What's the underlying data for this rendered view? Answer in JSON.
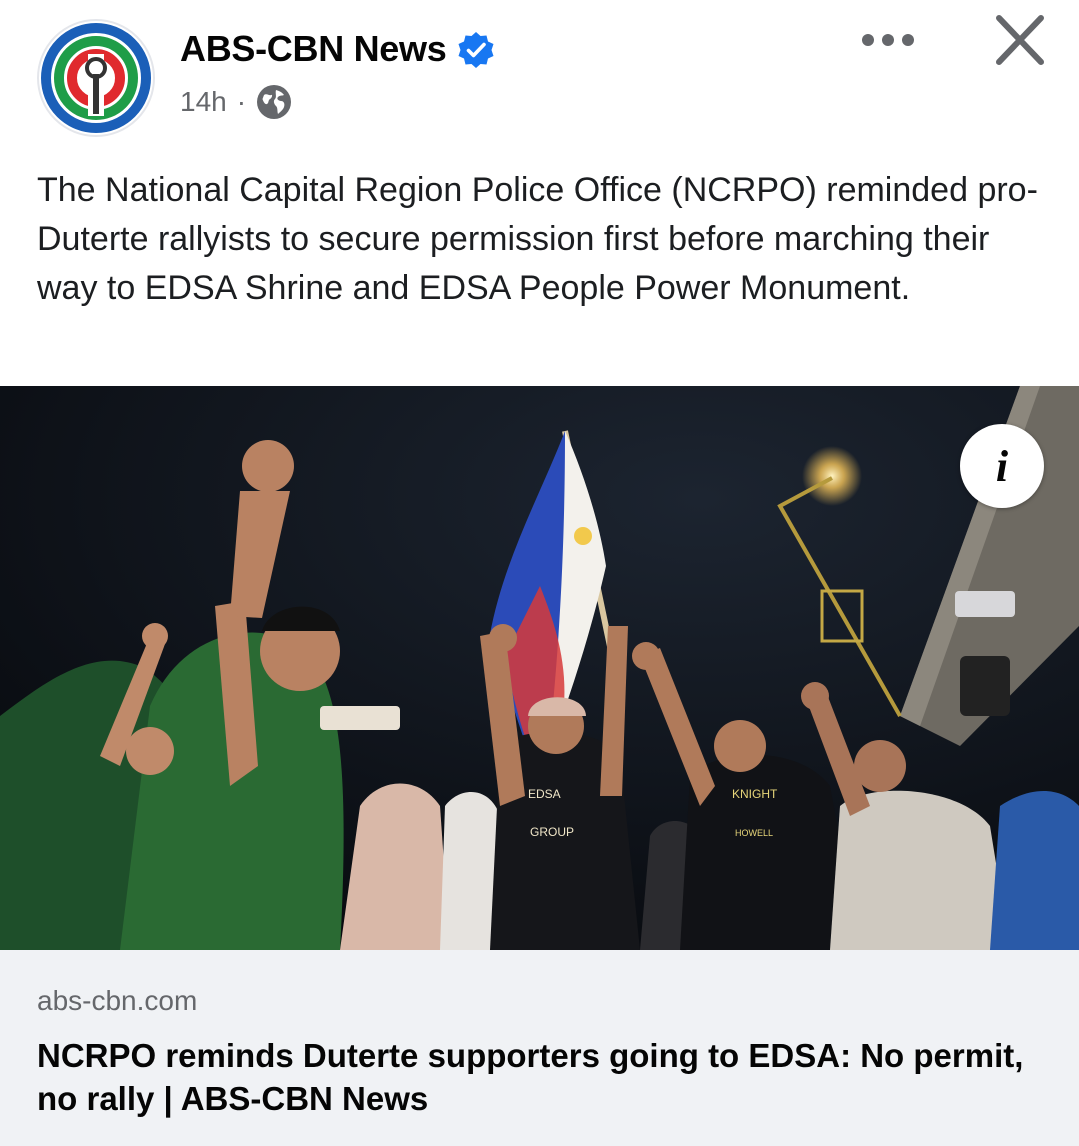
{
  "post": {
    "page_name": "ABS-CBN News",
    "time": "14h",
    "separator": "·",
    "audience_icon": "globe-icon",
    "text": "The National Capital Region Police Office (NCRPO) reminded pro-Duterte rallyists to secure permission first before marching their way to EDSA Shrine and EDSA People Power Monument."
  },
  "photo": {
    "info_icon": "info-icon",
    "info_label": "i",
    "shirt_text_1": "EDSA",
    "shirt_text_2": "GROUP",
    "shirt_text_3": "KNIGHT",
    "shirt_text_4": "HOWELL"
  },
  "link": {
    "domain": "abs-cbn.com",
    "title": "NCRPO reminds Duterte supporters going to EDSA: No permit, no rally | ABS-CBN News"
  },
  "colors": {
    "verified": "#1877f2",
    "logo_red": "#e02a2e",
    "logo_green": "#1f9d48",
    "logo_blue": "#1b5fb8",
    "card_bg": "#f0f2f5"
  }
}
